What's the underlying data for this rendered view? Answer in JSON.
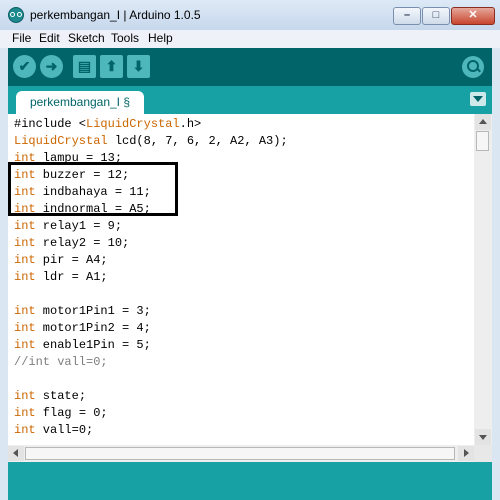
{
  "window": {
    "title": "perkembangan_I | Arduino 1.0.5",
    "icon": "arduino-logo-icon",
    "controls": {
      "minimize": "–",
      "maximize": "□",
      "close": "✕"
    }
  },
  "menu": {
    "items": [
      {
        "label": "File"
      },
      {
        "label": "Edit"
      },
      {
        "label": "Sketch"
      },
      {
        "label": "Tools"
      },
      {
        "label": "Help"
      }
    ]
  },
  "toolbar": {
    "buttons": [
      {
        "name": "verify",
        "icon": "check-icon",
        "glyph": "✔"
      },
      {
        "name": "upload",
        "icon": "arrow-right-icon",
        "glyph": "➜"
      },
      {
        "name": "new",
        "icon": "new-file-icon",
        "glyph": "▤"
      },
      {
        "name": "open",
        "icon": "open-arrow-up-icon",
        "glyph": "⬆"
      },
      {
        "name": "save",
        "icon": "save-arrow-down-icon",
        "glyph": "⬇"
      }
    ],
    "serial_monitor_icon": "magnifier-icon"
  },
  "tab": {
    "label": "perkembangan_I §"
  },
  "code": {
    "lines": [
      {
        "type": "include",
        "pre": "#include <",
        "lib": "LiquidCrystal",
        "post": ".h>"
      },
      {
        "type": "type-decl",
        "kw": "LiquidCrystal",
        "rest": " lcd(8, 7, 6, 2, A2, A3);"
      },
      {
        "type": "decl",
        "kw": "int",
        "rest": " lampu = 13;"
      },
      {
        "type": "decl",
        "kw": "int",
        "rest": " buzzer = 12;"
      },
      {
        "type": "decl",
        "kw": "int",
        "rest": " indbahaya = 11;"
      },
      {
        "type": "decl",
        "kw": "int",
        "rest": " indnormal = A5;"
      },
      {
        "type": "decl",
        "kw": "int",
        "rest": " relay1 = 9;"
      },
      {
        "type": "decl",
        "kw": "int",
        "rest": " relay2 = 10;"
      },
      {
        "type": "decl",
        "kw": "int",
        "rest": " pir = A4;"
      },
      {
        "type": "decl",
        "kw": "int",
        "rest": " ldr = A1;"
      },
      {
        "type": "blank"
      },
      {
        "type": "decl",
        "kw": "int",
        "rest": " motor1Pin1 = 3;"
      },
      {
        "type": "decl",
        "kw": "int",
        "rest": " motor1Pin2 = 4;"
      },
      {
        "type": "decl",
        "kw": "int",
        "rest": " enable1Pin = 5;"
      },
      {
        "type": "comment",
        "text": "//int vall=0;"
      },
      {
        "type": "blank"
      },
      {
        "type": "decl",
        "kw": "int",
        "rest": " state;"
      },
      {
        "type": "decl",
        "kw": "int",
        "rest": " flag = 0;"
      },
      {
        "type": "decl",
        "kw": "int",
        "rest": " vall=0;"
      }
    ]
  },
  "colors": {
    "toolbar_bg": "#006468",
    "tabbar_bg": "#17a1a5",
    "keyword": "#cc6600",
    "comment": "#7e7e7e"
  }
}
